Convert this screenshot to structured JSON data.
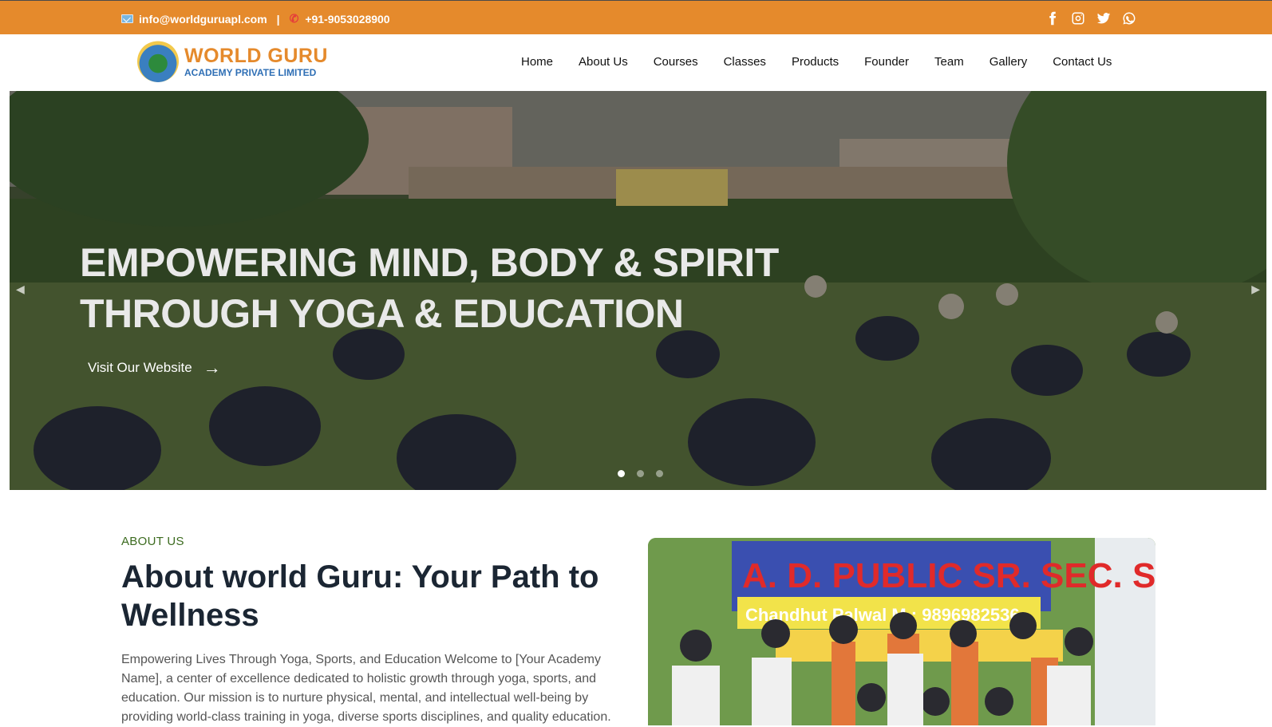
{
  "topbar": {
    "email": "info@worldguruapl.com",
    "separator": "|",
    "phone": "+91-9053028900",
    "social_icons": [
      "facebook-icon",
      "instagram-icon",
      "twitter-icon",
      "whatsapp-icon"
    ]
  },
  "logo": {
    "line1": "WORLD GURU",
    "line2": "ACADEMY PRIVATE LIMITED"
  },
  "nav": {
    "items": [
      "Home",
      "About Us",
      "Courses",
      "Classes",
      "Products",
      "Founder",
      "Team",
      "Gallery",
      "Contact Us"
    ]
  },
  "hero": {
    "headline_line1": "EMPOWERING MIND, BODY & SPIRIT",
    "headline_line2": "THROUGH YOGA & EDUCATION",
    "cta": "Visit Our Website",
    "slides": 3,
    "active_slide": 1
  },
  "about": {
    "eyebrow": "ABOUT US",
    "title": "About world Guru: Your Path to Wellness",
    "body": "Empowering Lives Through Yoga, Sports, and Education Welcome to [Your Academy Name], a center of excellence dedicated to holistic growth through yoga, sports, and education. Our mission is to nurture physical, mental, and intellectual well-being by providing world-class training in yoga, diverse sports disciplines, and quality education."
  },
  "photo": {
    "banner_line1": "A. D. PUBLIC SR. SEC. SCHOOL",
    "banner_line2": "Chandhut Palwal M : 9896982536"
  },
  "colors": {
    "accent_orange": "#e58a2c",
    "logo_blue": "#2f6fb5",
    "eyebrow_green": "#3c6b1f",
    "heading_dark": "#1b2633"
  }
}
